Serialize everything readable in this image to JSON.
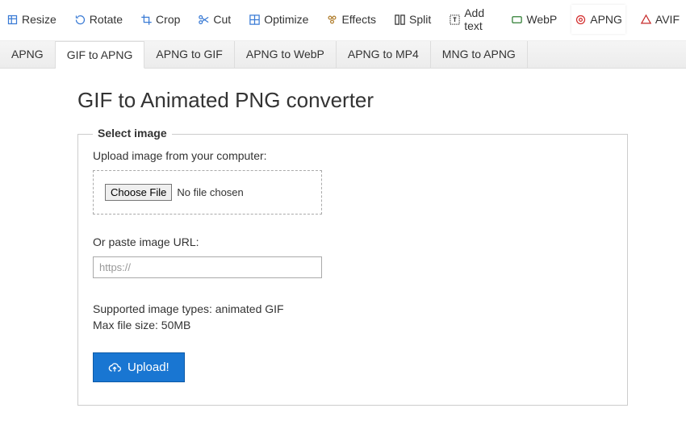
{
  "toolbar": {
    "items": [
      {
        "label": "Resize",
        "icon": "resize",
        "color": "#3a7bd5",
        "active": false
      },
      {
        "label": "Rotate",
        "icon": "rotate",
        "color": "#3a7bd5",
        "active": false
      },
      {
        "label": "Crop",
        "icon": "crop",
        "color": "#3a7bd5",
        "active": false
      },
      {
        "label": "Cut",
        "icon": "cut",
        "color": "#3a7bd5",
        "active": false
      },
      {
        "label": "Optimize",
        "icon": "optimize",
        "color": "#3a7bd5",
        "active": false
      },
      {
        "label": "Effects",
        "icon": "effects",
        "color": "#b07d2b",
        "active": false
      },
      {
        "label": "Split",
        "icon": "split",
        "color": "#333",
        "active": false
      },
      {
        "label": "Add text",
        "icon": "addtext",
        "color": "#333",
        "active": false
      },
      {
        "label": "WebP",
        "icon": "webp",
        "color": "#2e7d32",
        "active": false
      },
      {
        "label": "APNG",
        "icon": "apng",
        "color": "#d32f2f",
        "active": true
      },
      {
        "label": "AVIF",
        "icon": "avif",
        "color": "#c62828",
        "active": false
      }
    ]
  },
  "subtabs": {
    "items": [
      {
        "label": "APNG",
        "active": false
      },
      {
        "label": "GIF to APNG",
        "active": true
      },
      {
        "label": "APNG to GIF",
        "active": false
      },
      {
        "label": "APNG to WebP",
        "active": false
      },
      {
        "label": "APNG to MP4",
        "active": false
      },
      {
        "label": "MNG to APNG",
        "active": false
      }
    ]
  },
  "page": {
    "title": "GIF to Animated PNG converter"
  },
  "form": {
    "legend": "Select image",
    "upload_label": "Upload image from your computer:",
    "choose_file_button": "Choose File",
    "file_status": "No file chosen",
    "url_label": "Or paste image URL:",
    "url_placeholder": "https://",
    "supported_text": "Supported image types: animated GIF",
    "max_file_size": "Max file size: 50MB",
    "upload_button": "Upload!"
  }
}
